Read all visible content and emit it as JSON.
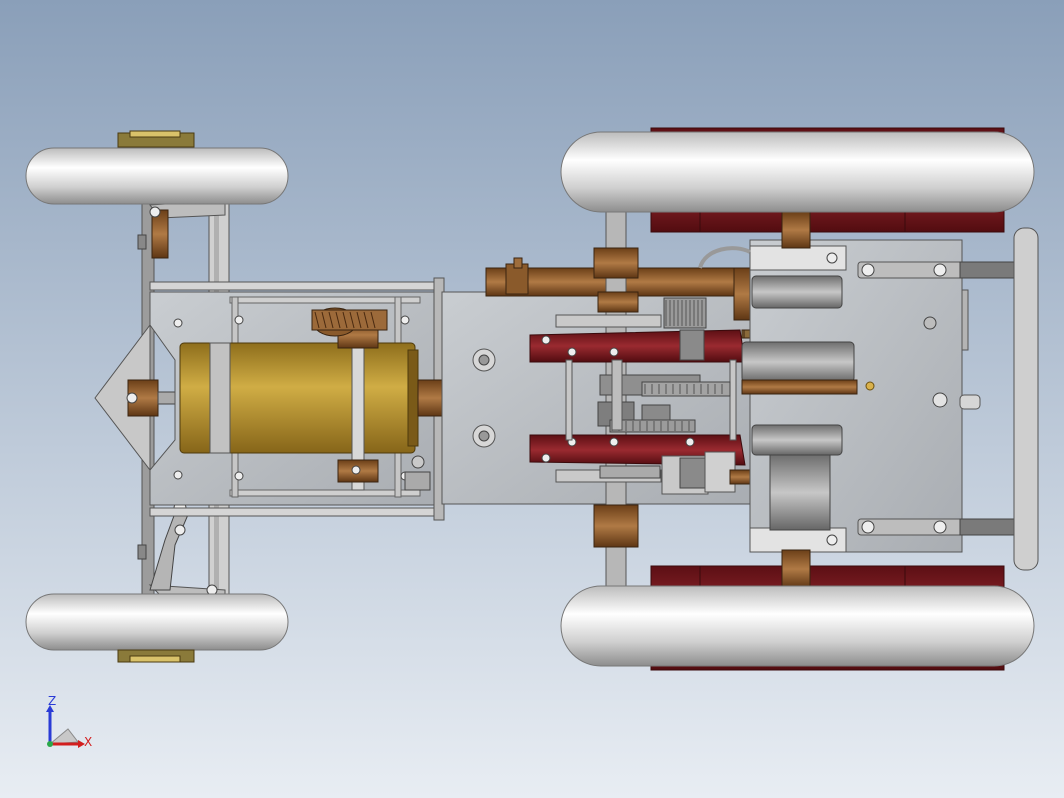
{
  "viewport": {
    "background_top": "#8a9fb9",
    "background_bottom": "#e8edf3"
  },
  "triad": {
    "z_label": "Z",
    "x_label": "X",
    "z_color": "#2a3bd6",
    "x_color": "#d21e1e",
    "y_color": "#2aa84a"
  },
  "model": {
    "tire_color": "#d8d8d8",
    "frame_color": "#b9b9b9",
    "motor_color": "#b8952e",
    "bronze_color": "#8a5a2b",
    "maroon_color": "#7a1a1f"
  }
}
